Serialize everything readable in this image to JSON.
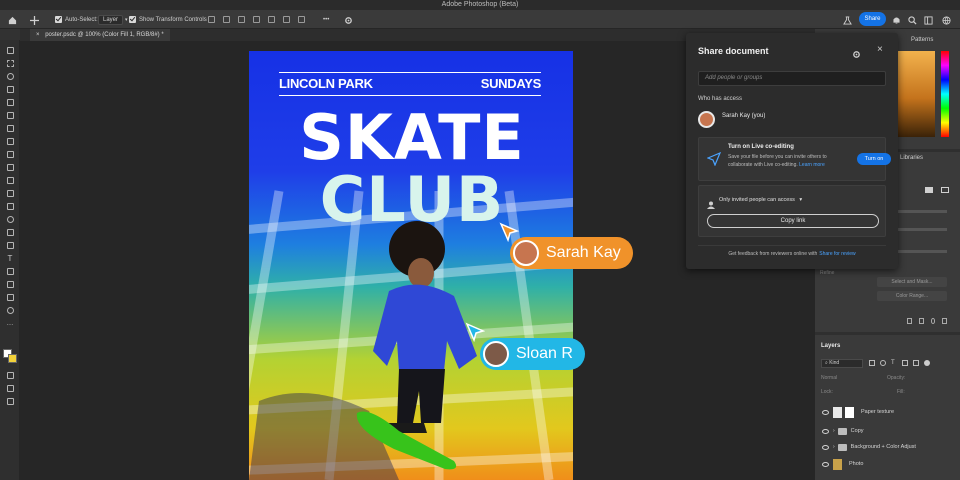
{
  "window": {
    "title": "Adobe Photoshop (Beta)"
  },
  "options_bar": {
    "auto_select_label": "Auto-Select:",
    "auto_select_value": "Layer",
    "transform_label": "Show Transform Controls",
    "more_label": "•••",
    "share_label": "Share"
  },
  "tab": {
    "label": "poster.psdc @ 100% (Color Fill 1, RGB/8#) *"
  },
  "poster": {
    "top_left": "LINCOLN PARK",
    "top_right": "SUNDAYS",
    "headline_1": "SKATE",
    "headline_2": "CLUB"
  },
  "collaborators": [
    {
      "name": "Sarah Kay",
      "color": "#f0922a"
    },
    {
      "name": "Sloan R",
      "color": "#22b7e6"
    }
  ],
  "share_panel": {
    "title": "Share document",
    "input_placeholder": "Add people or groups",
    "who_label": "Who has access",
    "user_name": "Sarah Kay (you)",
    "coedit_title": "Turn on Live co-editing",
    "coedit_desc_1": "Save your file before you can invite others to",
    "coedit_desc_2": "collaborate with Live co-editing.",
    "learn_more": "Learn more",
    "turn_on_label": "Turn on",
    "access_label": "Only invited people can access",
    "copy_link_label": "Copy link",
    "feedback_text": "Get feedback from reviewers online with",
    "feedback_link": "Share for review"
  },
  "right_panels": {
    "patterns_tab": "Patterns",
    "libraries_tab": "Libraries",
    "layers_title": "Layers",
    "kind_label": "Kind",
    "blend_mode": "Normal",
    "opacity_label": "Opacity:",
    "lock_label": "Lock:",
    "fill_label": "Fill:",
    "select_mask_label": "Select and Mask...",
    "color_range_label": "Color Range...",
    "refine_label": "Refine",
    "layers": [
      {
        "name": "Paper texture",
        "type": "layer"
      },
      {
        "name": "Copy",
        "type": "group"
      },
      {
        "name": "Background + Color Adjust",
        "type": "group"
      },
      {
        "name": "Photo",
        "type": "layer"
      }
    ]
  }
}
